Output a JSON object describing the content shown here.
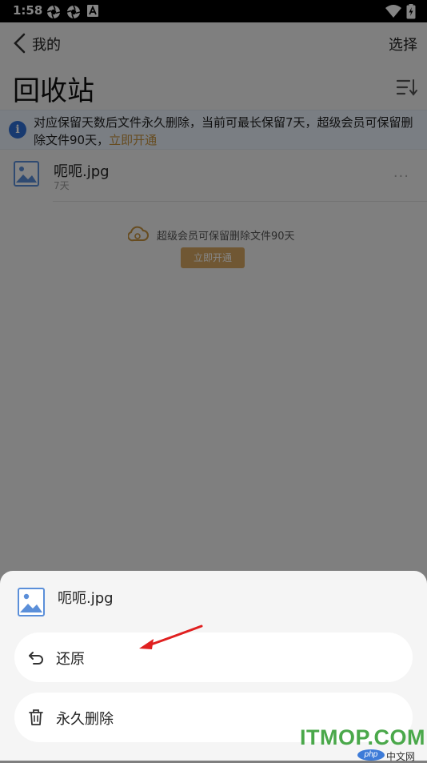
{
  "status_bar": {
    "time": "1:58"
  },
  "app_bar": {
    "back_label": "我的",
    "select_label": "选择"
  },
  "page_title": "回收站",
  "info_banner": {
    "text_line1": "对应保留天数后文件永久删除，当前可最长保留7天，超级会员可保留删",
    "text_line2": "除文件90天，",
    "link_label": "立即开通"
  },
  "files": [
    {
      "name": "呃呃.jpg",
      "days_left": "7天"
    }
  ],
  "promo": {
    "text": "超级会员可保留删除文件90天",
    "button_label": "立即开通"
  },
  "bottom_sheet": {
    "filename": "呃呃.jpg",
    "actions": [
      {
        "label": "还原",
        "icon": "undo-icon"
      },
      {
        "label": "永久删除",
        "icon": "trash-icon"
      }
    ]
  },
  "watermark": {
    "main": "ITMOP.COM",
    "php": "php",
    "cn": "中文网"
  },
  "colors": {
    "accent_gold": "#d6a862",
    "info_blue": "#2f6fd6",
    "annotation_red": "#e02020",
    "watermark_green": "#4aa84a"
  }
}
